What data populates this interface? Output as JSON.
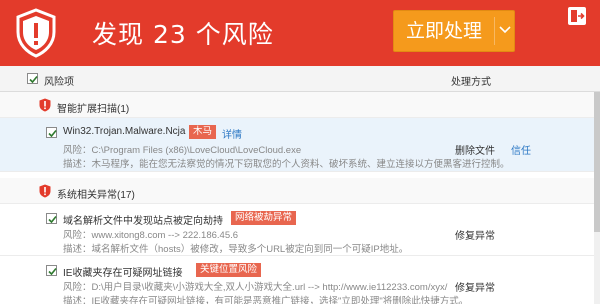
{
  "header": {
    "title": "发现 23 个风险",
    "action_button": "立即处理",
    "bg_color": "#e33b2b",
    "button_color": "#f59a1c"
  },
  "columns": {
    "risk": "风险项",
    "handling": "处理方式"
  },
  "groups": [
    {
      "title": "智能扩展扫描(1)",
      "items": [
        {
          "name": "Win32.Trojan.Malware.Ncja",
          "tag": "木马",
          "detail_link": "详情",
          "risk_line": "风险：C:\\Program Files (x86)\\LoveCloud\\LoveCloud.exe",
          "desc_line": "描述：木马程序，能在您无法察觉的情况下窃取您的个人资料、破坏系统、建立连接以方便黑客进行控制。",
          "action": "删除文件",
          "action2": "信任"
        }
      ]
    },
    {
      "title": "系统相关异常(17)",
      "items": [
        {
          "name": "域名解析文件中发现站点被定向劫持",
          "tag": "网络被劫异常",
          "risk_line": "风险：www.xitong8.com --> 222.186.45.6",
          "desc_line": "描述：域名解析文件（hosts）被修改，导致多个URL被定向到同一个可疑IP地址。",
          "action": "修复异常"
        },
        {
          "name": "IE收藏夹存在可疑网址链接",
          "tag": "关键位置风险",
          "risk_line": "风险：D:\\用户目录\\收藏夹\\小游戏大全,双人小游戏大全.url --> http://www.ie112233.com/xyx/",
          "desc_line": "描述：IE收藏夹存在可疑网址链接，有可能是恶意推广链接，选择\"立即处理\"将删除此快捷方式。",
          "action": "修复异常"
        }
      ]
    }
  ]
}
